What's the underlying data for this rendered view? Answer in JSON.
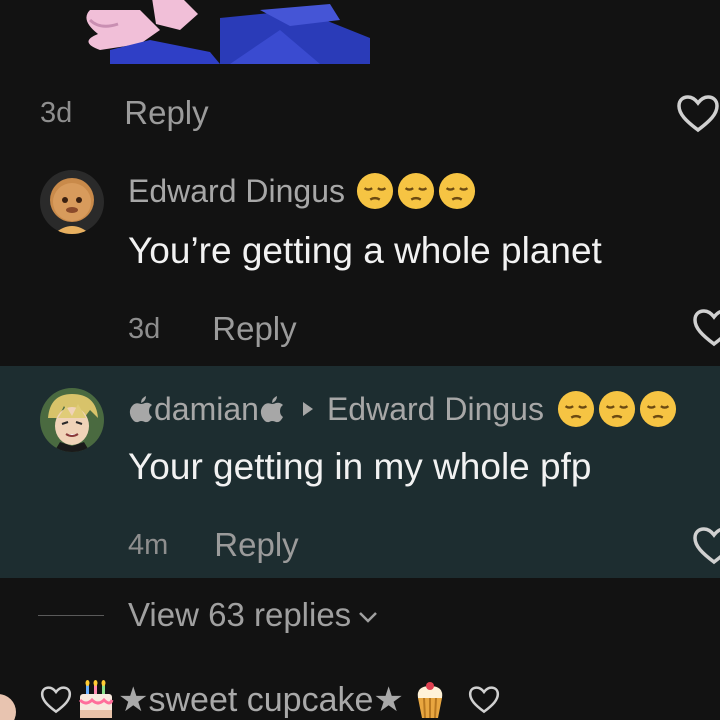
{
  "comments": [
    {
      "time": "3d",
      "reply_label": "Reply"
    },
    {
      "username": "Edward Dingus",
      "text": "You’re getting a whole planet",
      "time": "3d",
      "reply_label": "Reply",
      "emoji_name": "pensive-face"
    },
    {
      "username": "damian",
      "reply_to": "Edward Dingus",
      "text": "Your getting in my whole pfp",
      "time": "4m",
      "reply_label": "Reply",
      "emoji_name": "pensive-face"
    }
  ],
  "view_replies": {
    "label": "View 63 replies"
  },
  "next_comment": {
    "username": "★sweet cupcake★"
  },
  "colors": {
    "background": "#121212",
    "highlight": "#1d2d30",
    "text": "#f2f2f2",
    "muted": "#9a9a9a",
    "emoji": "#f6c443"
  }
}
